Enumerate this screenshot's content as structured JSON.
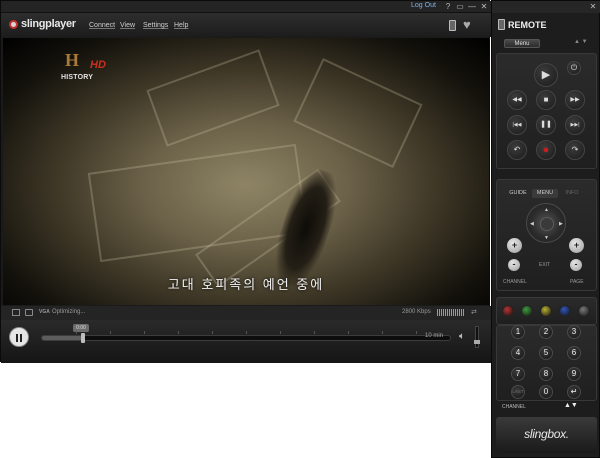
{
  "player": {
    "titlebar": {
      "logout_label": "Log Out",
      "buttons": [
        "?",
        "▭",
        "—",
        "✕"
      ]
    },
    "app_name": "slingplayer",
    "menu": [
      "Connect",
      "View",
      "Settings",
      "Help"
    ],
    "video": {
      "channel_logo_letter": "H",
      "channel_logo_hd": "HD",
      "channel_logo_name": "HISTORY",
      "subtitle": "고대 호피족의 예언 중에"
    },
    "status": {
      "resolution": "VGA",
      "text": "Optimizing...",
      "bitrate": "2800 Kbps",
      "aspect_icon": "⇄"
    },
    "controls": {
      "state": "playing",
      "timeline_position": 0.1,
      "live_badge": "0:00",
      "duration": "10 min",
      "volume_level": 0.3
    }
  },
  "remote": {
    "title": "REMOTE",
    "menu_button": "Menu",
    "nav_arrows": "▲ ▼",
    "transport": {
      "play": "▶",
      "power": "⏻",
      "rewind": "◀◀",
      "stop": "■",
      "fast_forward": "▶▶",
      "skip_back": "|◀◀",
      "pause": "❚❚",
      "skip_forward": "▶▶|",
      "back": "↶",
      "record": "●",
      "replay": "↷"
    },
    "tabs": [
      "GUIDE",
      "MENU",
      "INFO"
    ],
    "dpad": {
      "up": "▲",
      "down": "▼",
      "left": "◀",
      "right": "▶"
    },
    "exit_label": "EXIT",
    "channel_label": "CHANNEL",
    "page_label": "PAGE",
    "plus": "+",
    "minus": "-",
    "color_keys": [
      "#b83232",
      "#3f9a3f",
      "#b8b032",
      "#3256b8",
      "#7a7a7a"
    ],
    "keypad": [
      "1",
      "2",
      "3",
      "4",
      "5",
      "6",
      "7",
      "8",
      "9",
      "LAST",
      "0",
      "↵"
    ],
    "channel_bar_label": "CHANNEL",
    "channel_bar_arrows": "▲▼",
    "brand": "slingbox."
  }
}
